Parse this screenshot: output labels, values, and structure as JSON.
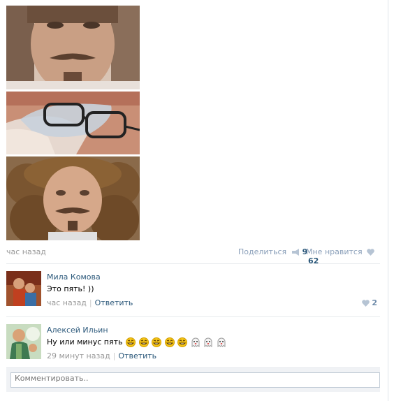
{
  "post": {
    "time": "час назад",
    "share_label": "Поделиться",
    "share_count": "9",
    "like_label": "Мне нравится",
    "like_count": "62"
  },
  "comments": [
    {
      "author": "Мила Комова",
      "text": "Это пять! ))",
      "time": "час назад",
      "reply_label": "Ответить",
      "likes": "2"
    },
    {
      "author": "Алексей Ильин",
      "text": "Ну или минус пять",
      "emojis": [
        "grin",
        "grin",
        "grin",
        "grin",
        "grin",
        "ghost",
        "ghost",
        "ghost"
      ],
      "time": "29 минут назад",
      "reply_label": "Ответить"
    }
  ],
  "comment_box": {
    "placeholder": "Комментировать.."
  },
  "colors": {
    "link": "#2b587a",
    "muted": "#999999",
    "action": "#8a9fb9"
  }
}
